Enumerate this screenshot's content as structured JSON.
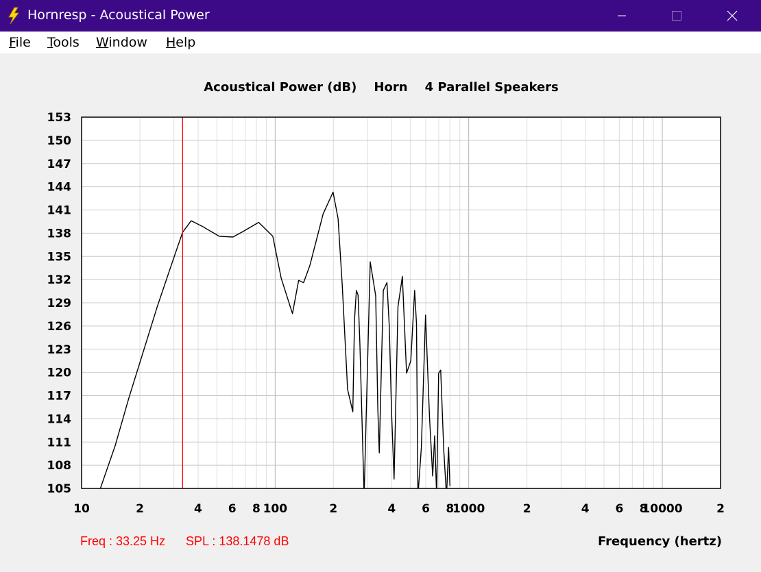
{
  "window": {
    "title": "Hornresp - Acoustical Power",
    "app_icon": "lightning-bolt-icon",
    "controls": [
      "minimize-icon",
      "maximize-icon",
      "close-icon"
    ]
  },
  "menu": {
    "items": [
      {
        "mnemonic": "F",
        "rest": "ile"
      },
      {
        "mnemonic": "T",
        "rest": "ools"
      },
      {
        "mnemonic": "W",
        "rest": "indow"
      },
      {
        "mnemonic": "H",
        "rest": "elp"
      }
    ]
  },
  "colors": {
    "titlebar": "#3c0a87",
    "trace": "#000000",
    "cursor": "#ff0000",
    "grid": "#c8c8c8",
    "plot_background": "#ffffff"
  },
  "readout": {
    "freq": "Freq : 33.25 Hz",
    "spl": "SPL : 138.1478 dB"
  },
  "chart_data": {
    "type": "line",
    "title": "Acoustical Power (dB)    Horn    4 Parallel Speakers",
    "xlabel": "Frequency (hertz)",
    "ylabel": "",
    "x_scale": "log",
    "xlim": [
      10,
      20000
    ],
    "ylim": [
      105,
      153
    ],
    "grid": true,
    "yticks": [
      153,
      150,
      147,
      144,
      141,
      138,
      135,
      132,
      129,
      126,
      123,
      120,
      117,
      114,
      111,
      108,
      105
    ],
    "xtick_labels": [
      {
        "value": 10,
        "label": "10"
      },
      {
        "value": 20,
        "label": "2"
      },
      {
        "value": 40,
        "label": "4"
      },
      {
        "value": 60,
        "label": "6"
      },
      {
        "value": 80,
        "label": "8"
      },
      {
        "value": 100,
        "label": "100"
      },
      {
        "value": 200,
        "label": "2"
      },
      {
        "value": 400,
        "label": "4"
      },
      {
        "value": 600,
        "label": "6"
      },
      {
        "value": 800,
        "label": "8"
      },
      {
        "value": 1000,
        "label": "1000"
      },
      {
        "value": 2000,
        "label": "2"
      },
      {
        "value": 4000,
        "label": "4"
      },
      {
        "value": 6000,
        "label": "6"
      },
      {
        "value": 8000,
        "label": "8"
      },
      {
        "value": 10000,
        "label": "10000"
      },
      {
        "value": 20000,
        "label": "2"
      }
    ],
    "cursor": {
      "x": 33.25,
      "y": 138.1478
    },
    "series": [
      {
        "x": [
          12.5,
          14.9,
          17.6,
          20.9,
          24.6,
          29.0,
          33.25,
          36.8,
          41.9,
          51.4,
          60.5,
          68.1,
          82.2,
          97.2,
          107.4,
          122.9,
          132.2,
          140.2,
          151.1,
          177.1,
          199.2,
          211.3,
          222.1,
          236.8,
          251.8,
          257.1,
          262.7,
          268.1,
          273.9,
          288.1,
          309.9,
          330.7,
          339.2,
          345.1,
          362.1,
          378.0,
          388.8,
          399.3,
          411.4,
          431.0,
          454.1,
          477.2,
          502.3,
          525.4,
          537.3,
          546.4,
          569.5,
          598.3,
          627.1,
          651.1,
          666.7,
          682.7,
          699.2,
          716.7,
          743.1,
          767.7,
          787.1,
          800.0
        ],
        "y": [
          105.0,
          110.5,
          116.8,
          122.8,
          128.5,
          133.8,
          138.1,
          139.6,
          138.9,
          137.6,
          137.5,
          138.2,
          139.4,
          137.6,
          132.2,
          127.6,
          131.9,
          131.6,
          133.8,
          140.5,
          143.3,
          139.9,
          131.3,
          117.8,
          114.9,
          126.8,
          130.6,
          130.0,
          123.8,
          104.0,
          134.3,
          129.9,
          115.3,
          109.6,
          130.6,
          131.6,
          126.0,
          114.9,
          106.2,
          128.5,
          132.4,
          119.9,
          121.5,
          130.6,
          126.3,
          104.0,
          110.3,
          127.4,
          114.2,
          106.6,
          111.8,
          103.8,
          119.9,
          120.3,
          109.9,
          103.6,
          110.3,
          105.3
        ]
      }
    ]
  }
}
